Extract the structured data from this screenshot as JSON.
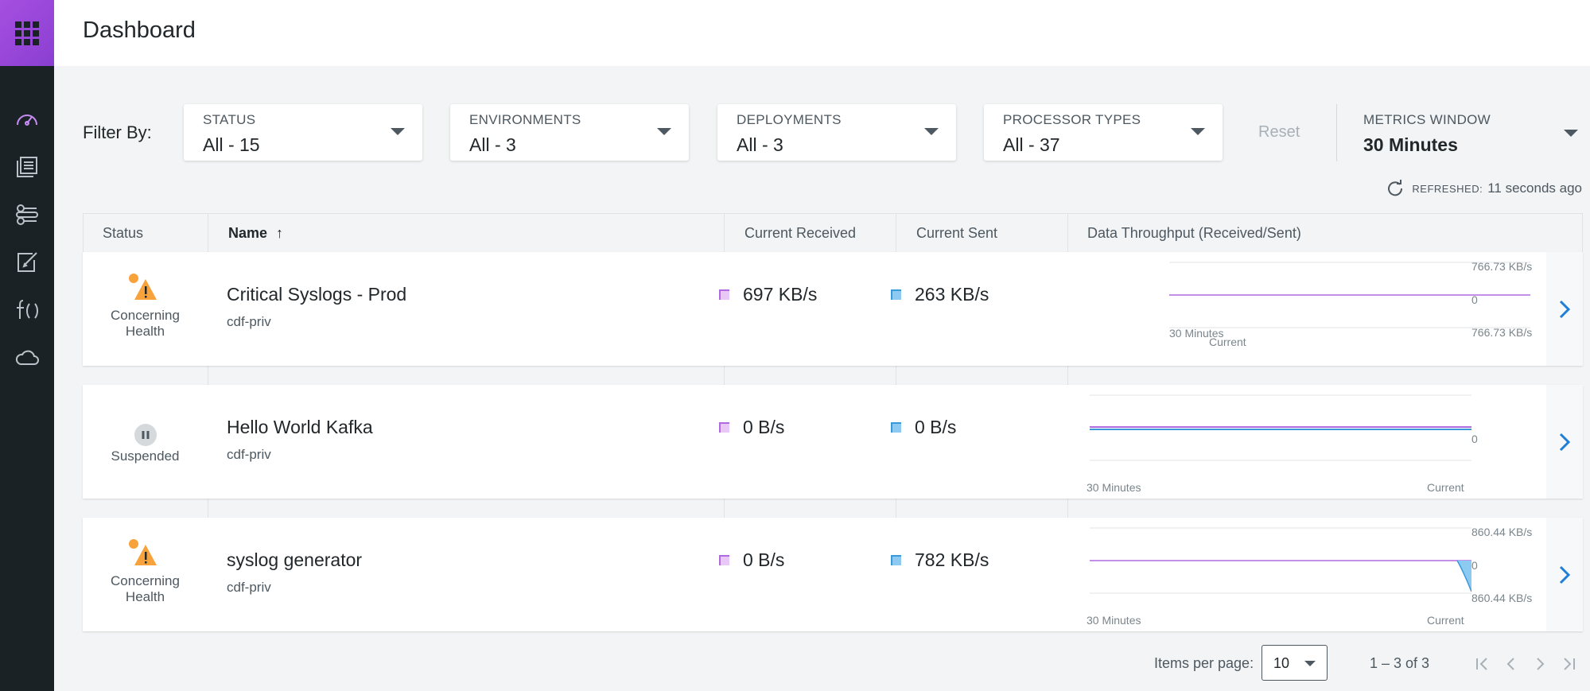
{
  "header": {
    "title": "Dashboard"
  },
  "sidebar": {
    "items": [
      {
        "icon": "dashboard-gauge-icon",
        "active": true
      },
      {
        "icon": "catalog-icon"
      },
      {
        "icon": "resources-icon"
      },
      {
        "icon": "edit-icon"
      },
      {
        "icon": "functions-icon"
      },
      {
        "icon": "cloud-icon"
      }
    ]
  },
  "filters": {
    "label": "Filter By:",
    "status": {
      "label": "STATUS",
      "value": "All - 15"
    },
    "environments": {
      "label": "ENVIRONMENTS",
      "value": "All - 3"
    },
    "deployments": {
      "label": "DEPLOYMENTS",
      "value": "All - 3"
    },
    "processor_types": {
      "label": "PROCESSOR TYPES",
      "value": "All - 37"
    },
    "reset_label": "Reset",
    "metrics_window": {
      "label": "METRICS WINDOW",
      "value": "30 Minutes"
    }
  },
  "refreshed": {
    "key": "REFRESHED:",
    "value": "11 seconds ago"
  },
  "table": {
    "columns": {
      "status": "Status",
      "name": "Name",
      "received": "Current Received",
      "sent": "Current Sent",
      "throughput": "Data Throughput (Received/Sent)"
    },
    "sort_indicator": "↑",
    "rows": [
      {
        "status": "Concerning Health",
        "status_line1": "Concerning",
        "status_line2": "Health",
        "name": "Critical Syslogs - Prod",
        "environment": "cdf-priv",
        "received": "697 KB/s",
        "sent": "263 KB/s",
        "chart": {
          "top_label": "766.73 KB/s",
          "zero_label": "0",
          "bottom_label": "766.73 KB/s",
          "x_start": "30 Minutes",
          "x_end": "Current"
        }
      },
      {
        "status": "Suspended",
        "status_line1": "Suspended",
        "status_line2": "",
        "name": "Hello World Kafka",
        "environment": "cdf-priv",
        "received": "0 B/s",
        "sent": "0 B/s",
        "chart": {
          "top_label": "",
          "zero_label": "0",
          "bottom_label": "",
          "x_start": "30 Minutes",
          "x_end": "Current"
        }
      },
      {
        "status": "Concerning Health",
        "status_line1": "Concerning",
        "status_line2": "Health",
        "name": "syslog generator",
        "environment": "cdf-priv",
        "received": "0 B/s",
        "sent": "782 KB/s",
        "chart": {
          "top_label": "860.44 KB/s",
          "zero_label": "0",
          "bottom_label": "860.44 KB/s",
          "x_start": "30 Minutes",
          "x_end": "Current"
        }
      }
    ]
  },
  "pagination": {
    "items_per_page_label": "Items per page:",
    "items_per_page": "10",
    "range": "1 – 3 of 3"
  },
  "colors": {
    "accent": "#8a3fd1",
    "received": "#b06ae0",
    "sent": "#3a9ad9",
    "warning": "#f7a23b",
    "link": "#1f7ed6"
  }
}
